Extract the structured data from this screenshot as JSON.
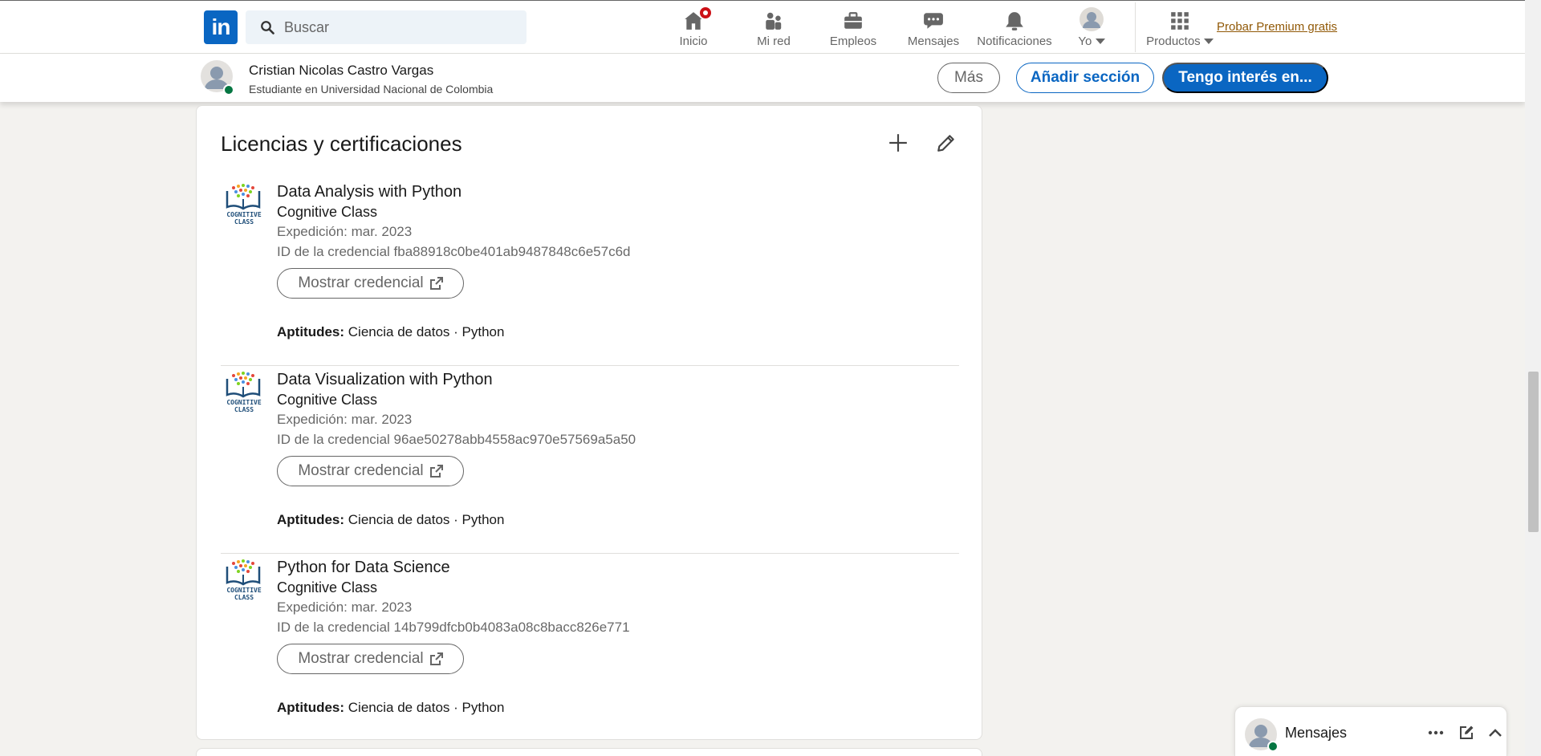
{
  "nav": {
    "logo_text": "in",
    "search_placeholder": "Buscar",
    "items": [
      {
        "label": "Inicio",
        "icon": "home-icon"
      },
      {
        "label": "Mi red",
        "icon": "network-icon"
      },
      {
        "label": "Empleos",
        "icon": "briefcase-icon"
      },
      {
        "label": "Mensajes",
        "icon": "chat-icon"
      },
      {
        "label": "Notificaciones",
        "icon": "bell-icon"
      },
      {
        "label": "Yo",
        "icon": "avatar"
      },
      {
        "label": "Productos",
        "icon": "grid-icon"
      }
    ],
    "premium_link": "Probar Premium gratis"
  },
  "profile_bar": {
    "name": "Cristian Nicolas Castro Vargas",
    "headline": "Estudiante en Universidad Nacional de Colombia",
    "more_label": "Más",
    "add_section_label": "Añadir sección",
    "interested_label": "Tengo interés en..."
  },
  "section": {
    "title": "Licencias y certificaciones",
    "skills_label": "Aptitudes:",
    "show_credential_label": "Mostrar credencial",
    "certs": [
      {
        "title": "Data Analysis with Python",
        "issuer": "Cognitive Class",
        "date": "Expedición: mar. 2023",
        "credential_id": "ID de la credencial fba88918c0be401ab9487848c6e57c6d",
        "skills": "Ciencia de datos · Python"
      },
      {
        "title": "Data Visualization with Python",
        "issuer": "Cognitive Class",
        "date": "Expedición: mar. 2023",
        "credential_id": "ID de la credencial 96ae50278abb4558ac970e57569a5a50",
        "skills": "Ciencia de datos · Python"
      },
      {
        "title": "Python for Data Science",
        "issuer": "Cognitive Class",
        "date": "Expedición: mar. 2023",
        "credential_id": "ID de la credencial 14b799dfcb0b4083a08c8bacc826e771",
        "skills": "Ciencia de datos · Python"
      }
    ]
  },
  "messaging": {
    "title": "Mensajes"
  },
  "colors": {
    "brand": "#0a66c2",
    "online": "#057642",
    "notification": "#cc1016",
    "premium": "#915907"
  }
}
